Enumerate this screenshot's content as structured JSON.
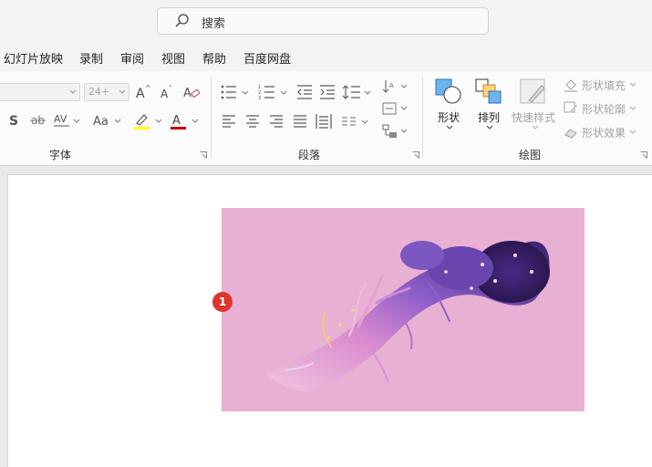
{
  "search": {
    "placeholder": "搜索"
  },
  "tabs": [
    "幻灯片放映",
    "录制",
    "审阅",
    "视图",
    "帮助",
    "百度网盘"
  ],
  "ribbon": {
    "font_group": {
      "label": "字体",
      "font_size": "24+"
    },
    "paragraph_group": {
      "label": "段落"
    },
    "drawing_group": {
      "label": "绘图",
      "shape_label": "形状",
      "arrange_label": "排列",
      "quick_styles_label": "快速样式",
      "shape_fill_label": "形状填充",
      "shape_outline_label": "形状轮廓",
      "shape_effects_label": "形状效果"
    }
  },
  "slide": {
    "picture_background": "#e8b0d2",
    "badge": "1"
  },
  "colors": {
    "accent_underline": "#c00000",
    "highlight": "#ffff00",
    "badge": "#e0342e"
  }
}
